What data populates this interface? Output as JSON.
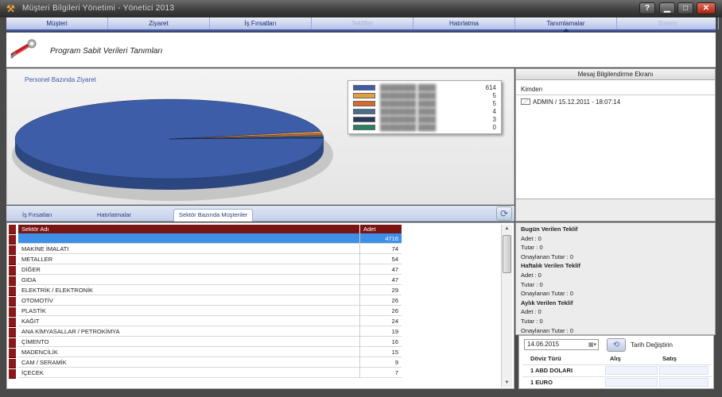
{
  "window": {
    "title": "Müşteri Bilgileri Yönetimi - Yönetici 2013"
  },
  "menu": [
    {
      "label": "Müşteri",
      "enabled": true,
      "active": false
    },
    {
      "label": "Ziyaret",
      "enabled": true,
      "active": false
    },
    {
      "label": "İş Fırsatları",
      "enabled": true,
      "active": false
    },
    {
      "label": "Teklifler",
      "enabled": false,
      "active": false
    },
    {
      "label": "Hatırlatma",
      "enabled": true,
      "active": false
    },
    {
      "label": "Tanımlamalar",
      "enabled": true,
      "active": true
    },
    {
      "label": "Sistem",
      "enabled": false,
      "active": false
    }
  ],
  "header": {
    "title": "Program Sabit Verileri Tanımları"
  },
  "chart": {
    "title": "Personel Bazında Ziyaret",
    "chart_data": {
      "type": "pie",
      "title": "Personel Bazında Ziyaret",
      "series": [
        {
          "name": "",
          "value": 614,
          "color": "#3d5da8"
        },
        {
          "name": "",
          "value": 5,
          "color": "#e0a040"
        },
        {
          "name": "",
          "value": 5,
          "color": "#d86a2a"
        },
        {
          "name": "",
          "value": 4,
          "color": "#4a6f8c"
        },
        {
          "name": "",
          "value": 3,
          "color": "#2a3a5a"
        },
        {
          "name": "",
          "value": 0,
          "color": "#2a8060"
        }
      ],
      "legend": "top-right"
    },
    "legend_values": [
      "614",
      "5",
      "5",
      "4",
      "3",
      "0"
    ]
  },
  "messages": {
    "title": "Mesaj Bilgilendirme Ekranı",
    "from_label": "Kimden",
    "entries": [
      {
        "text": "ADMIN / 15.12.2011 - 18:07:14"
      }
    ]
  },
  "tabs": [
    {
      "label": "İş Fırsatları",
      "active": false
    },
    {
      "label": "Hatırlatmalar",
      "active": false
    },
    {
      "label": "Sektör Bazında Müşteriler",
      "active": true
    }
  ],
  "table": {
    "headers": {
      "name": "Sektör Adı",
      "count": "Adet"
    },
    "rows": [
      {
        "name": "",
        "count": "4716",
        "selected": true
      },
      {
        "name": "MAKİNE İMALATI",
        "count": "74"
      },
      {
        "name": "METALLER",
        "count": "54"
      },
      {
        "name": "DİĞER",
        "count": "47"
      },
      {
        "name": "GIDA",
        "count": "47"
      },
      {
        "name": "ELEKTRİK / ELEKTRONİK",
        "count": "29"
      },
      {
        "name": "OTOMOTİV",
        "count": "26"
      },
      {
        "name": "PLASTİK",
        "count": "26"
      },
      {
        "name": "KAĞIT",
        "count": "24"
      },
      {
        "name": "ANA KİMYASALLAR / PETROKİMYA",
        "count": "19"
      },
      {
        "name": "ÇİMENTO",
        "count": "16"
      },
      {
        "name": "MADENCİLİK",
        "count": "15"
      },
      {
        "name": "CAM / SERAMİK",
        "count": "9"
      },
      {
        "name": "İÇECEK",
        "count": "7"
      }
    ]
  },
  "stats": [
    {
      "title": "Bugün Verilen Teklif",
      "adet": "Adet :  0",
      "tutar": "Tutar :  0",
      "onay": "Onaylanan Tutar :  0"
    },
    {
      "title": "Haftalık Verilen Teklif",
      "adet": "Adet :  0",
      "tutar": "Tutar :  0",
      "onay": "Onaylanan Tutar :  0"
    },
    {
      "title": "Aylık Verilen Teklif",
      "adet": "Adet :  0",
      "tutar": "Tutar :  0",
      "onay": "Onaylanan Tutar :  0"
    }
  ],
  "currency": {
    "date": "14.06.2015",
    "change_label": "Tarih Değiştirin",
    "headers": {
      "type": "Döviz Türü",
      "buy": "Alış",
      "sell": "Satış"
    },
    "rows": [
      {
        "name": "1 ABD DOLARI"
      },
      {
        "name": "1 EURO"
      }
    ]
  }
}
